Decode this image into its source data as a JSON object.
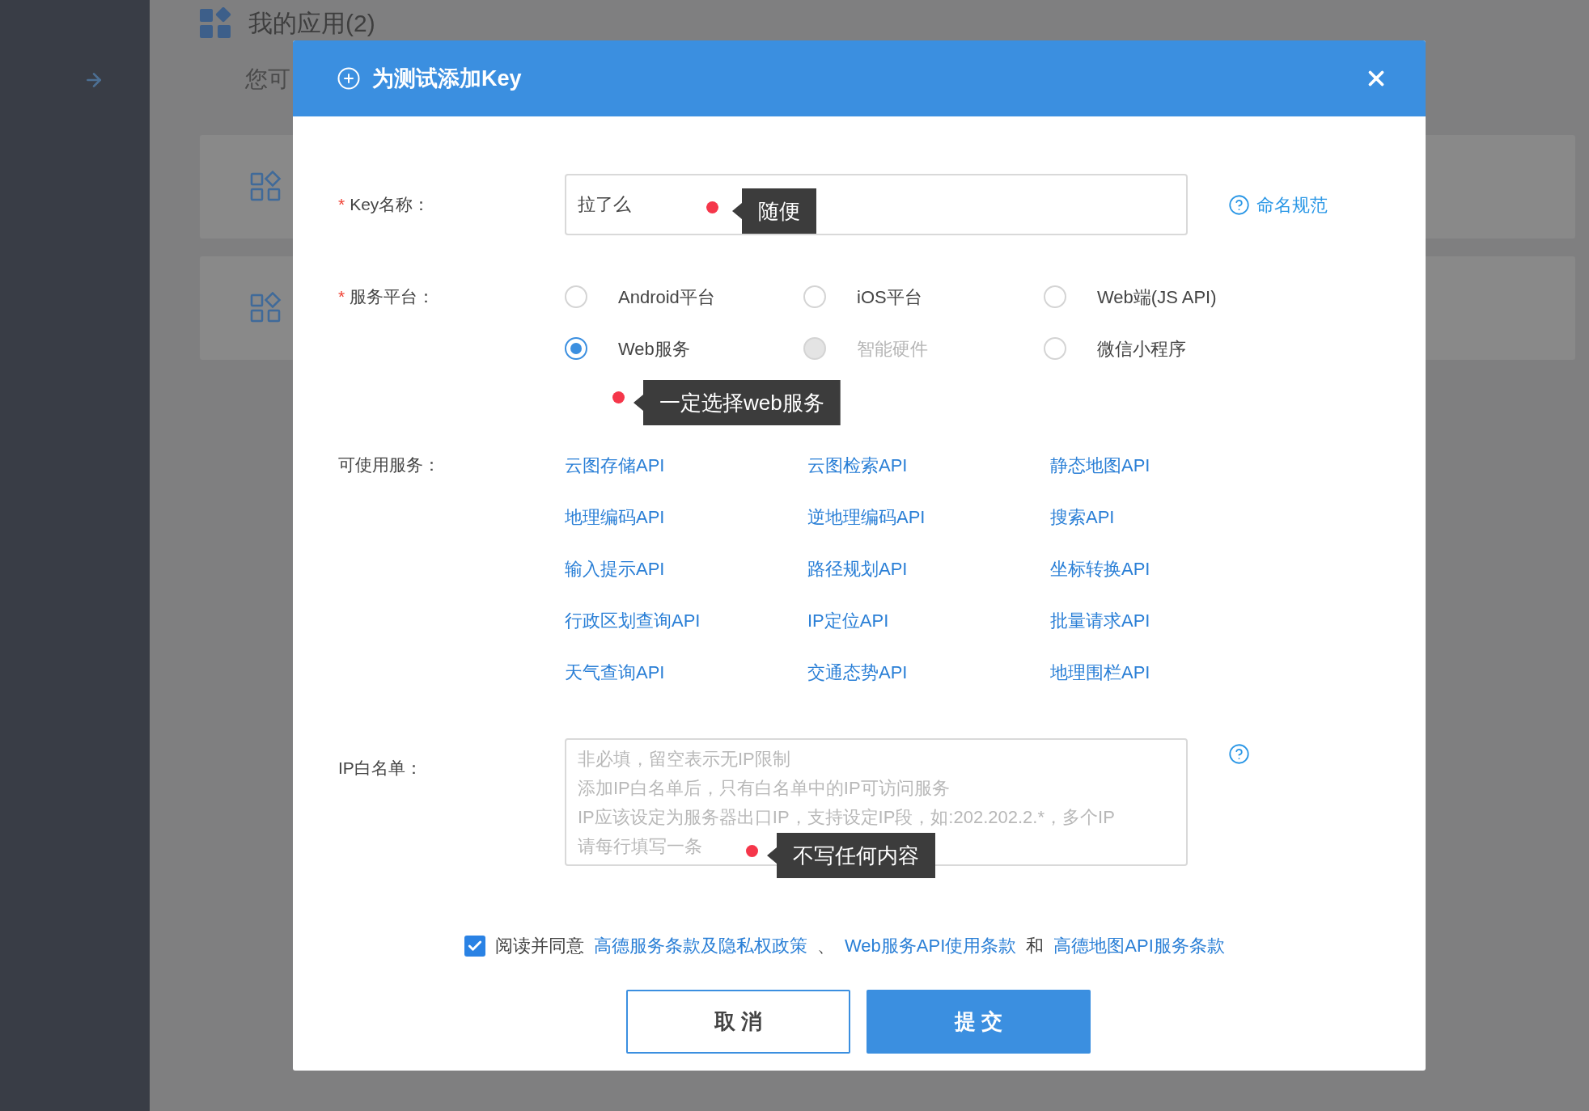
{
  "background": {
    "title": "我的应用(2)",
    "subtitle": "您可"
  },
  "dialog": {
    "title": "为测试添加Key",
    "key_name": {
      "required_mark": "*",
      "label": "Key名称：",
      "value": "拉了么",
      "help_link": "命名规范",
      "annotation": "随便"
    },
    "platform": {
      "required_mark": "*",
      "label": "服务平台：",
      "annotation": "一定选择web服务",
      "options": [
        {
          "label": "Android平台",
          "selected": false,
          "disabled": false
        },
        {
          "label": "iOS平台",
          "selected": false,
          "disabled": false
        },
        {
          "label": "Web端(JS API)",
          "selected": false,
          "disabled": false
        },
        {
          "label": "Web服务",
          "selected": true,
          "disabled": false
        },
        {
          "label": "智能硬件",
          "selected": false,
          "disabled": true
        },
        {
          "label": "微信小程序",
          "selected": false,
          "disabled": false
        }
      ]
    },
    "services": {
      "label": "可使用服务：",
      "items": [
        "云图存储API",
        "云图检索API",
        "静态地图API",
        "地理编码API",
        "逆地理编码API",
        "搜索API",
        "输入提示API",
        "路径规划API",
        "坐标转换API",
        "行政区划查询API",
        "IP定位API",
        "批量请求API",
        "天气查询API",
        "交通态势API",
        "地理围栏API"
      ]
    },
    "ip_whitelist": {
      "label": "IP白名单：",
      "placeholder": [
        "非必填，留空表示无IP限制",
        "添加IP白名单后，只有白名单中的IP可访问服务",
        "IP应该设定为服务器出口IP，支持设定IP段，如:202.202.2.*，多个IP",
        "请每行填写一条"
      ],
      "annotation": "不写任何内容"
    },
    "agreement": {
      "checked": true,
      "parts": [
        {
          "kind": "text",
          "text": "阅读并同意"
        },
        {
          "kind": "link",
          "text": "高德服务条款及隐私权政策"
        },
        {
          "kind": "text",
          "text": "、"
        },
        {
          "kind": "link",
          "text": "Web服务API使用条款"
        },
        {
          "kind": "text",
          "text": "和"
        },
        {
          "kind": "link",
          "text": "高德地图API服务条款"
        }
      ]
    },
    "buttons": [
      {
        "label": "取 消",
        "kind": "secondary"
      },
      {
        "label": "提 交",
        "kind": "primary"
      }
    ]
  }
}
